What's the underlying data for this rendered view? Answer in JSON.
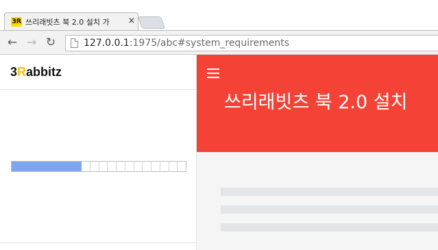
{
  "browser": {
    "tab": {
      "favicon_text": "3R",
      "title": "쓰리래빗츠 북 2.0 설치 가",
      "close_glyph": "×"
    },
    "nav": {
      "back_glyph": "←",
      "forward_glyph": "→",
      "reload_glyph": "↻"
    },
    "address": {
      "host": "127.0.0.1",
      "path": ":1975/abc#system_requirements"
    }
  },
  "sidebar": {
    "logo": {
      "prefix": "3",
      "highlight": "R",
      "suffix": "abbitz"
    },
    "progress": {
      "segments": 20,
      "filled_segments": 8,
      "fill_color": "#7da6ee"
    }
  },
  "main": {
    "header": {
      "title": "쓰리래빗츠 북 2.0 설치",
      "background_color": "#f44336"
    },
    "icons": {
      "menu": "hamburger-menu-icon"
    }
  }
}
